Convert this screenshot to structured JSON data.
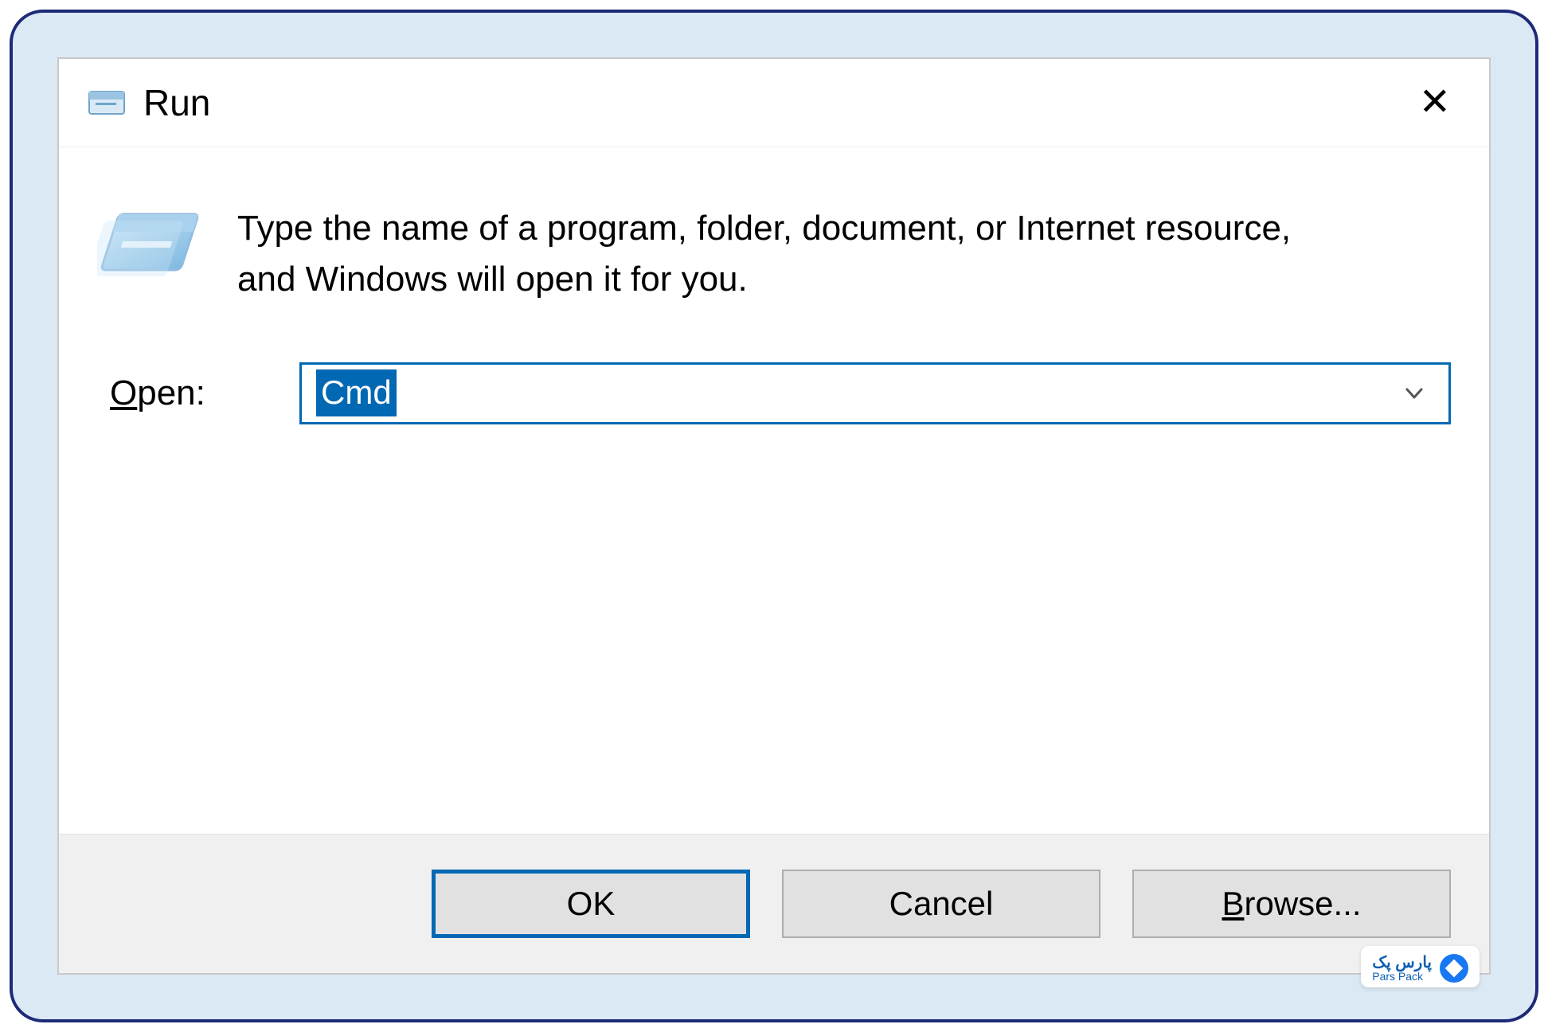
{
  "dialog": {
    "title": "Run",
    "description": "Type the name of a program, folder, document, or Internet resource, and Windows will open it for you.",
    "open_label_prefix": "O",
    "open_label_rest": "pen:",
    "input_value": "Cmd",
    "buttons": {
      "ok": "OK",
      "cancel": "Cancel",
      "browse_prefix": "B",
      "browse_rest": "rowse..."
    }
  },
  "watermark": {
    "line1": "پارس پک",
    "line2": "Pars Pack"
  }
}
